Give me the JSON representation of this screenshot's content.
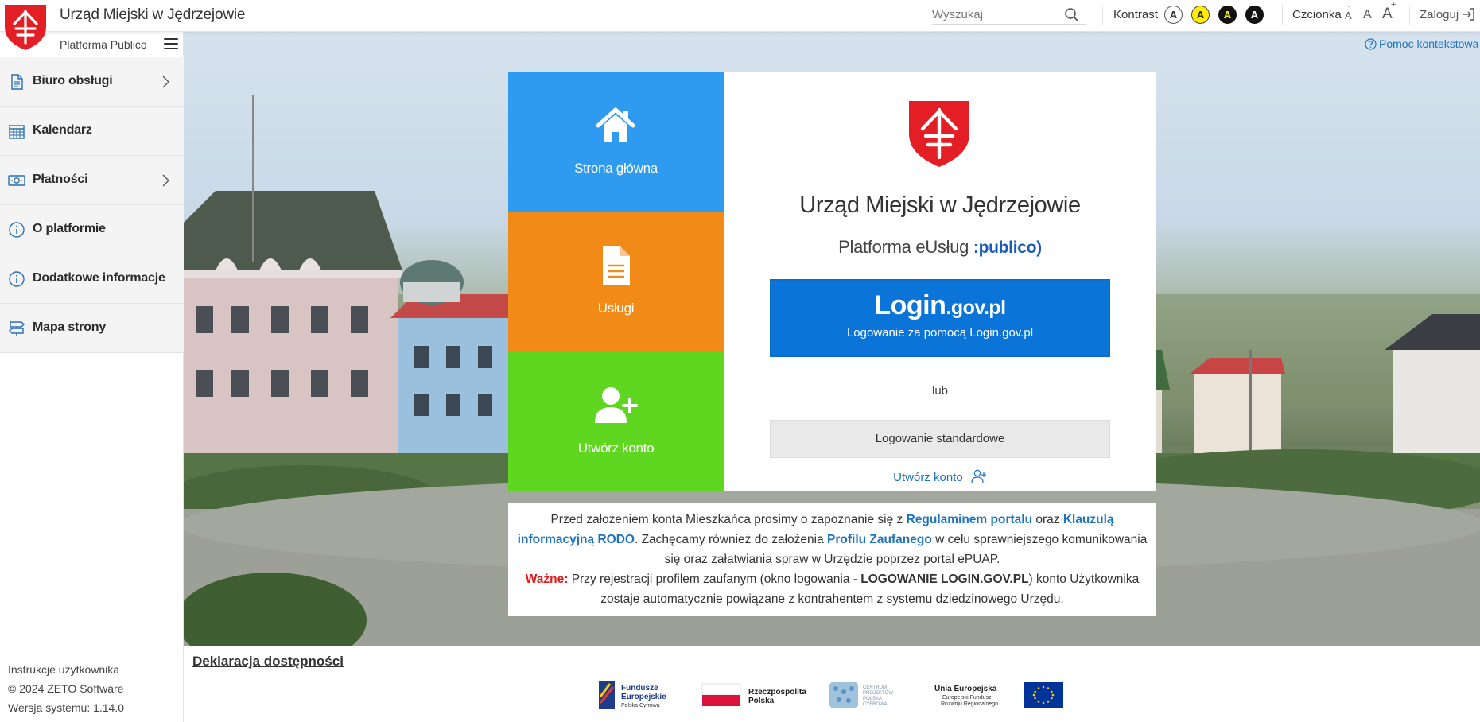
{
  "header": {
    "title": "Urząd Miejski w Jędrzejowie",
    "search_placeholder": "Wyszukaj",
    "contrast_label": "Kontrast",
    "contrast_options": [
      "A",
      "A",
      "A",
      "A"
    ],
    "font_label": "Czcionka",
    "font_sizes": [
      "A",
      "A",
      "A"
    ],
    "font_minus": "-",
    "font_plus": "+",
    "login_label": "Zaloguj"
  },
  "sidebar": {
    "platform_label": "Platforma Publico",
    "items": [
      {
        "label": "Biuro obsługi",
        "icon": "document-icon"
      },
      {
        "label": "Kalendarz",
        "icon": "calendar-icon"
      },
      {
        "label": "Płatności",
        "icon": "banknote-icon"
      },
      {
        "label": "O platformie",
        "icon": "info-icon"
      },
      {
        "label": "Dodatkowe informacje",
        "icon": "info-icon"
      },
      {
        "label": "Mapa strony",
        "icon": "signpost-icon"
      }
    ],
    "footer": {
      "manual": "Instrukcje użytkownika",
      "copyright": "© 2024 ZETO Software",
      "version": "Wersja systemu: 1.14.0"
    }
  },
  "help_link": "Pomoc kontekstowa",
  "tiles": [
    {
      "label": "Strona główna",
      "icon": "home-icon",
      "color": "#2f9bf0"
    },
    {
      "label": "Usługi",
      "icon": "document-icon",
      "color": "#f28a17"
    },
    {
      "label": "Utwórz konto",
      "icon": "add-user-icon",
      "color": "#5fd620"
    }
  ],
  "card": {
    "title": "Urząd Miejski w Jędrzejowie",
    "subtitle_prefix": "Platforma eUsług",
    "subtitle_brand": ":publico)",
    "logingov_main": "Login",
    "logingov_suffix": ".gov.pl",
    "logingov_sub": "Logowanie za pomocą Login.gov.pl",
    "or": "lub",
    "standard_login": "Logowanie standardowe",
    "create_account": "Utwórz konto"
  },
  "notice": {
    "p1": "Przed założeniem konta Mieszkańca prosimy o zapoznanie się z ",
    "link1": "Regulaminem portalu",
    "p2": " oraz ",
    "link2": "Klauzulą informacyjną RODO",
    "p3": ". Zachęcamy również do założenia ",
    "link3": "Profilu Zaufanego",
    "p4": " w celu sprawniejszego komunikowania się oraz załatwiania spraw w Urzędzie poprzez portal ePUAP.",
    "warn": "Ważne:",
    "p5": " Przy rejestracji profilem zaufanym (okno logowania - ",
    "strong": "LOGOWANIE LOGIN.GOV.PL",
    "p6": ") konto Użytkownika zostaje automatycznie powiązane z kontrahentem z systemu dziedzinowego Urzędu."
  },
  "footer": {
    "declaration": "Deklaracja dostępności",
    "logos": {
      "fe_line1": "Fundusze",
      "fe_line2": "Europejskie",
      "fe_line3": "Polska Cyfrowa",
      "rp_line1": "Rzeczpospolita",
      "rp_line2": "Polska",
      "cppc_line1": "CENTRUM",
      "cppc_line2": "PROJEKTÓW",
      "cppc_line3": "POLSKA",
      "cppc_line4": "CYFROWA",
      "ue_line1": "Unia Europejska",
      "ue_line2": "Europejski Fundusz",
      "ue_line3": "Rozwoju Regionalnego"
    }
  },
  "colors": {
    "logo_red": "#e31e24",
    "accent_blue": "#1e73be",
    "logingov_blue": "#0a74d9",
    "contrast_yellow": "#ffee00"
  }
}
